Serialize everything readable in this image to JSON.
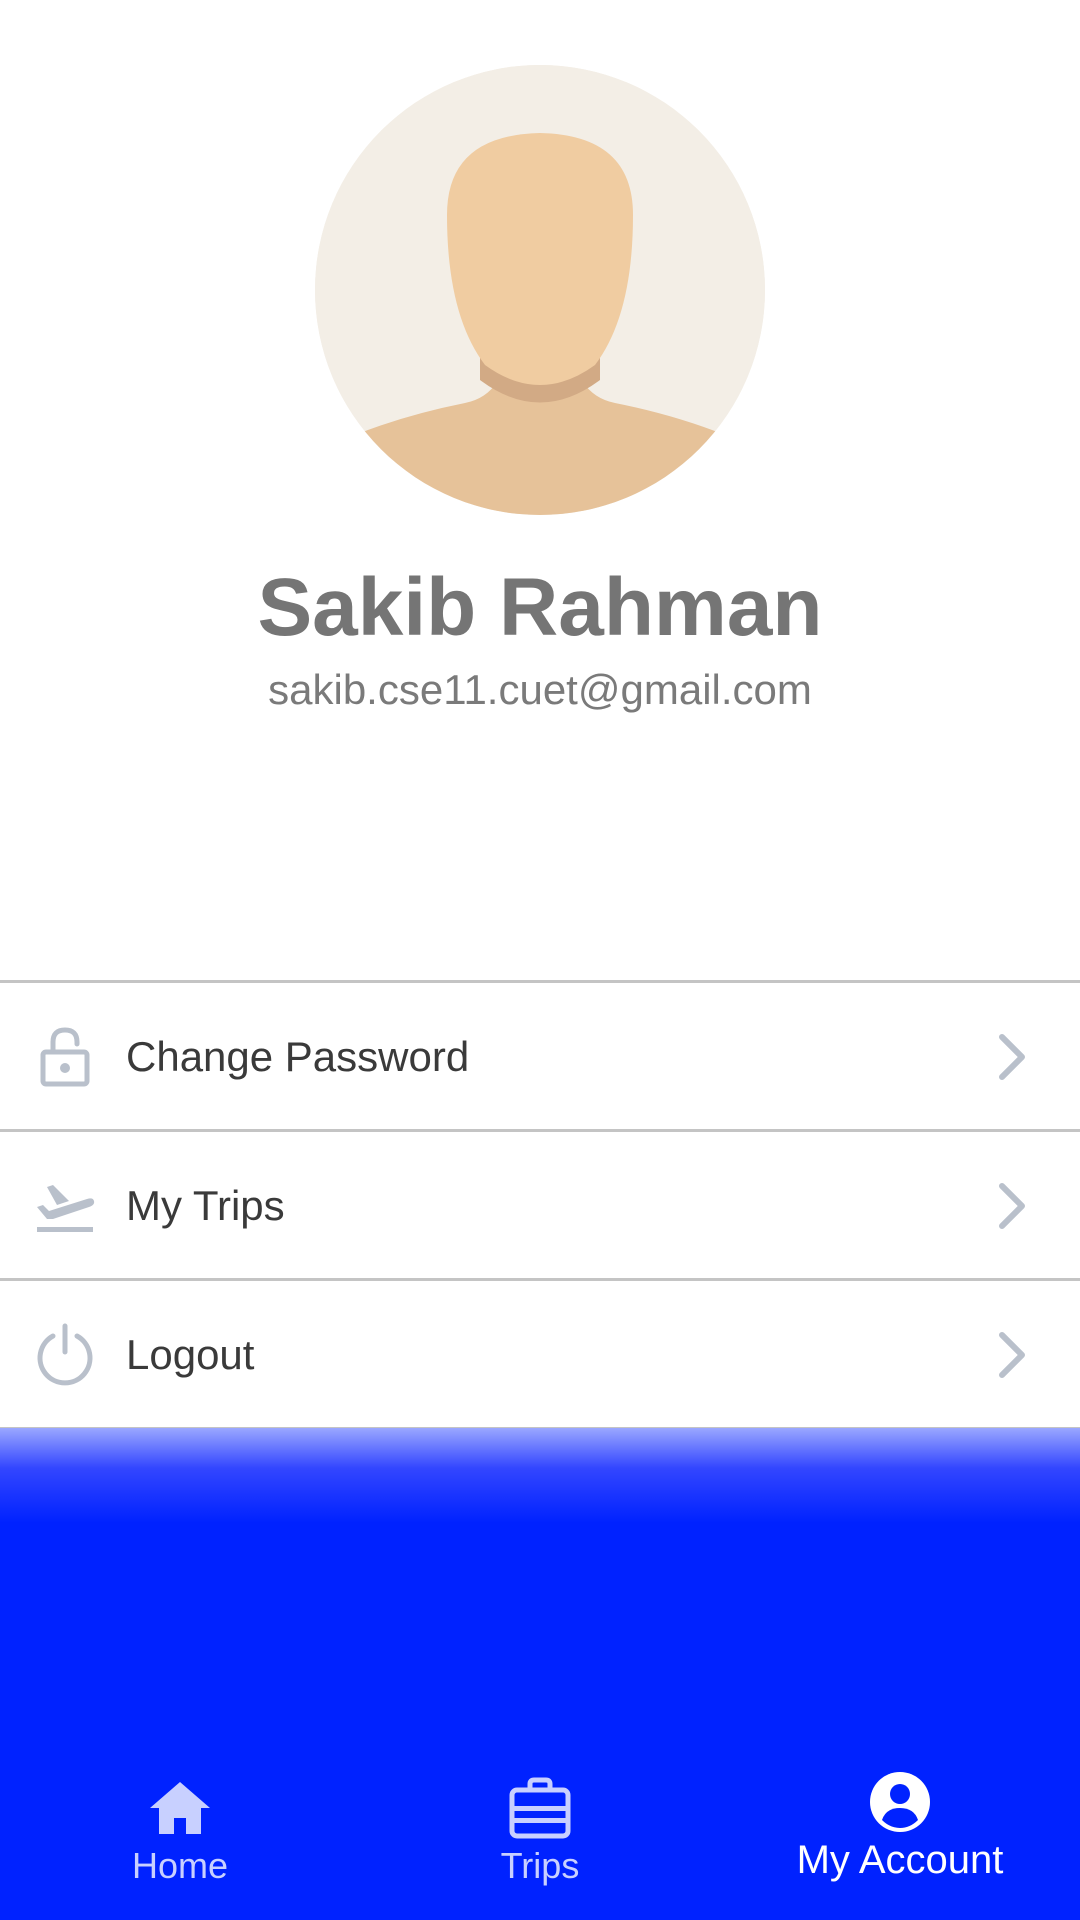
{
  "profile": {
    "name": "Sakib Rahman",
    "email": "sakib.cse11.cuet@gmail.com",
    "avatar_icon": "default-user-avatar"
  },
  "menu": {
    "items": [
      {
        "label": "Change Password",
        "icon": "lock-icon"
      },
      {
        "label": "My Trips",
        "icon": "flight-takeoff-icon"
      },
      {
        "label": "Logout",
        "icon": "power-icon"
      }
    ]
  },
  "bottom_nav": {
    "items": [
      {
        "label": "Home",
        "icon": "home-icon",
        "active": false
      },
      {
        "label": "Trips",
        "icon": "briefcase-icon",
        "active": false
      },
      {
        "label": "My Account",
        "icon": "account-circle-icon",
        "active": true
      }
    ]
  },
  "colors": {
    "nav_background": "#0022ff",
    "nav_label_inactive": "#c8d0ff",
    "nav_label_active": "#ffffff",
    "divider": "#c4c4c4",
    "icon_gray": "#b9c0cb",
    "name_text": "#757575"
  }
}
